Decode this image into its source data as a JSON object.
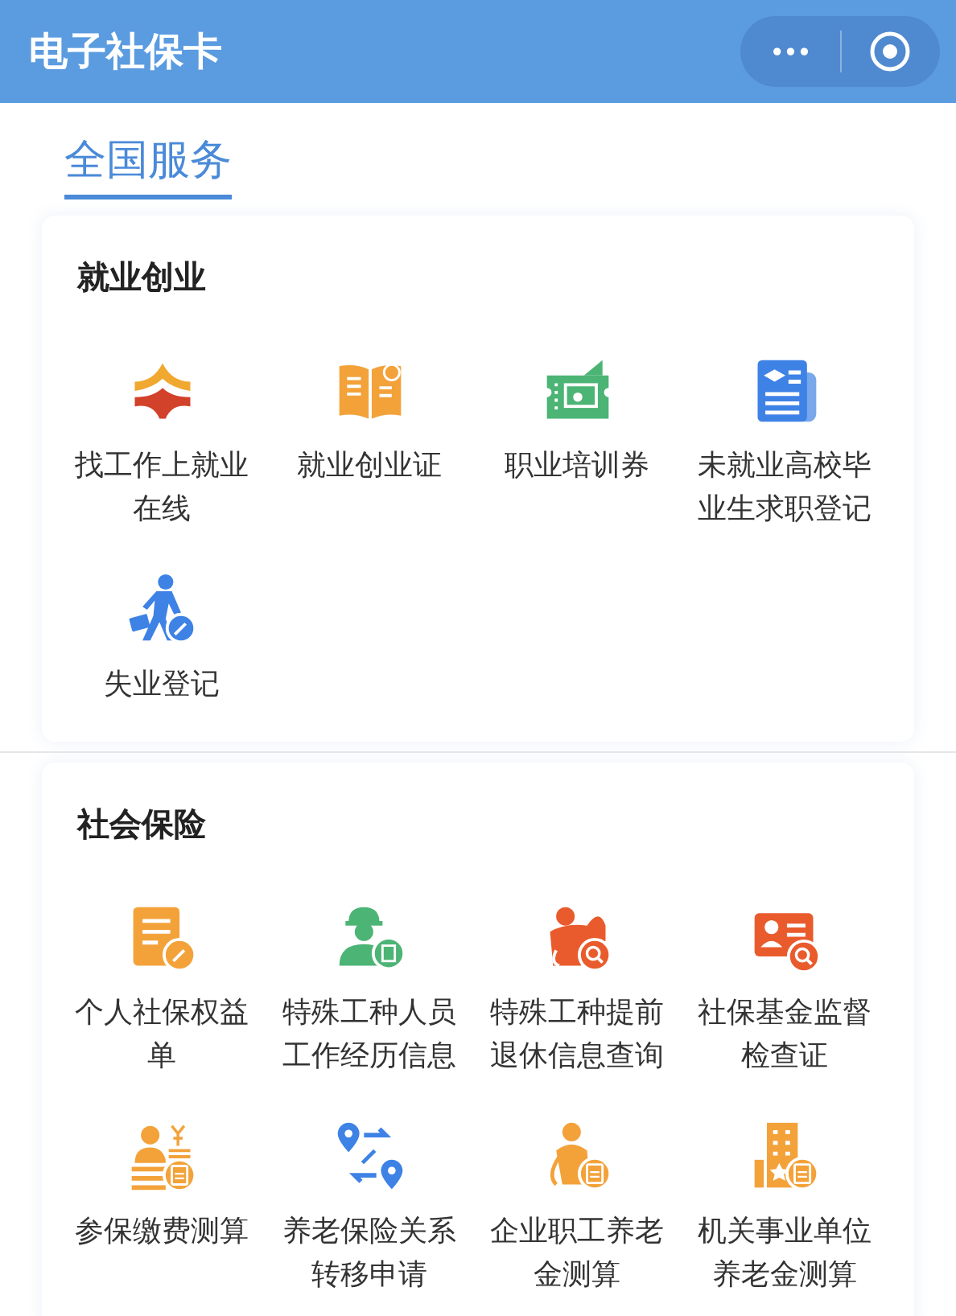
{
  "header": {
    "title": "电子社保卡",
    "more_button": "•••"
  },
  "tabs": [
    {
      "label": "全国服务",
      "selected": true
    }
  ],
  "sections": [
    {
      "title": "就业创业",
      "items": [
        {
          "label": "找工作上就业在线"
        },
        {
          "label": "就业创业证"
        },
        {
          "label": "职业培训券"
        },
        {
          "label": "未就业高校毕业生求职登记"
        },
        {
          "label": "失业登记"
        }
      ]
    },
    {
      "title": "社会保险",
      "items": [
        {
          "label": "个人社保权益单"
        },
        {
          "label": "特殊工种人员工作经历信息"
        },
        {
          "label": "特殊工种提前退休信息查询"
        },
        {
          "label": "社保基金监督检查证"
        },
        {
          "label": "参保缴费测算"
        },
        {
          "label": "养老保险关系转移申请"
        },
        {
          "label": "企业职工养老金测算"
        },
        {
          "label": "机关事业单位养老金测算"
        }
      ]
    }
  ]
}
